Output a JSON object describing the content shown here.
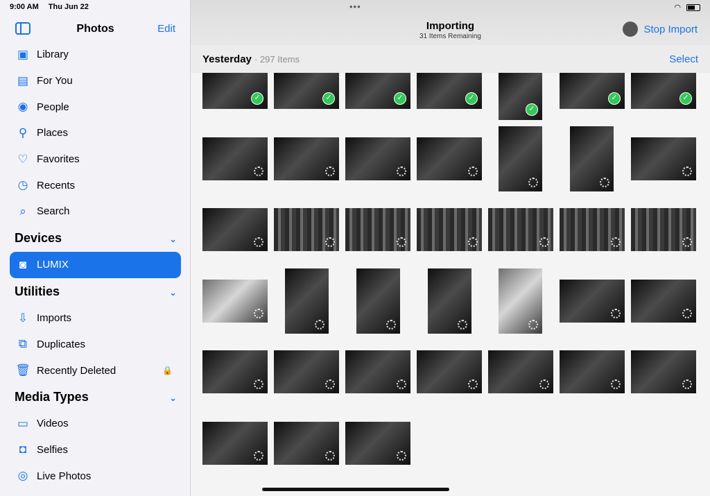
{
  "status": {
    "time": "9:00 AM",
    "date": "Thu Jun 22"
  },
  "sidebar": {
    "title": "Photos",
    "edit_label": "Edit",
    "items": [
      {
        "label": "Library",
        "icon": "library-icon"
      },
      {
        "label": "For You",
        "icon": "for-you-icon"
      },
      {
        "label": "People",
        "icon": "people-icon"
      },
      {
        "label": "Places",
        "icon": "places-icon"
      },
      {
        "label": "Favorites",
        "icon": "heart-icon"
      },
      {
        "label": "Recents",
        "icon": "clock-icon"
      },
      {
        "label": "Search",
        "icon": "search-icon"
      }
    ],
    "sections": {
      "devices": "Devices",
      "utilities": "Utilities",
      "media_types": "Media Types"
    },
    "devices": [
      {
        "label": "LUMIX",
        "icon": "camera-icon",
        "selected": true
      }
    ],
    "utilities": [
      {
        "label": "Imports",
        "icon": "import-icon"
      },
      {
        "label": "Duplicates",
        "icon": "duplicates-icon"
      },
      {
        "label": "Recently Deleted",
        "icon": "trash-icon",
        "locked": true
      }
    ],
    "media_types": [
      {
        "label": "Videos",
        "icon": "video-icon"
      },
      {
        "label": "Selfies",
        "icon": "selfie-icon"
      },
      {
        "label": "Live Photos",
        "icon": "live-photos-icon"
      }
    ]
  },
  "main": {
    "title": "Importing",
    "subtitle": "31 Items Remaining",
    "stop_label": "Stop Import",
    "section_title": "Yesterday",
    "section_count": "297 Items",
    "select_label": "Select"
  },
  "colors": {
    "accent": "#1a73e8",
    "check": "#34c759"
  }
}
